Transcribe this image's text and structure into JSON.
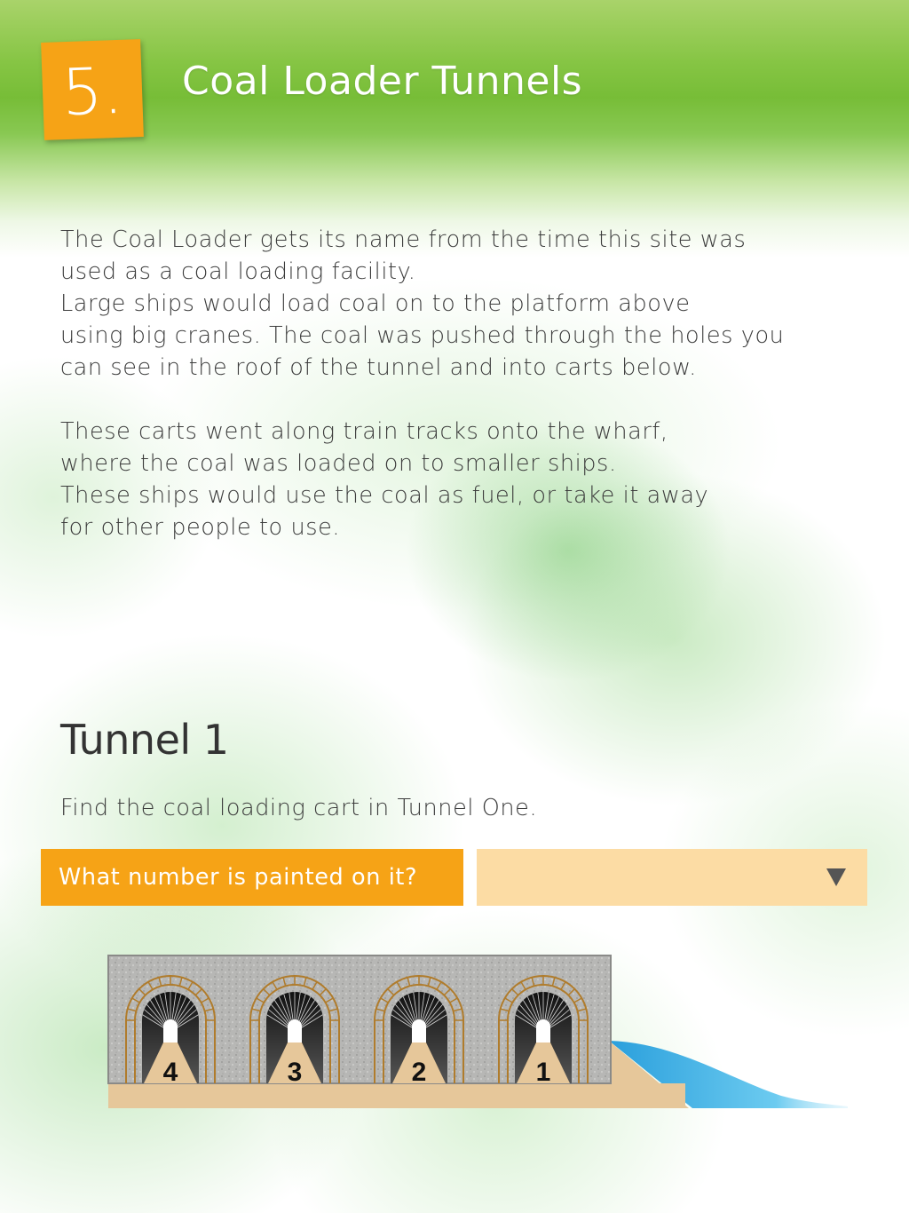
{
  "header": {
    "step_number": "5.",
    "title": "Coal Loader Tunnels"
  },
  "intro": {
    "paragraph_1_lines": [
      "The Coal Loader gets its name from the time this site was",
      "used as a coal loading facility.",
      "Large ships would load coal on to the platform above",
      "using big cranes. The coal was pushed through the holes you",
      "can see in the roof of the tunnel and into carts below."
    ],
    "paragraph_2_lines": [
      "These carts went along train tracks onto the wharf,",
      "where the coal was loaded on to smaller ships.",
      "These ships would use the coal as fuel, or take it away",
      "for other people to use."
    ]
  },
  "activity": {
    "heading": "Tunnel 1",
    "instruction": "Find the coal loading cart in Tunnel One.",
    "question": "What number is painted on it?",
    "selected_answer": ""
  },
  "diagram": {
    "tunnel_labels": [
      "4",
      "3",
      "2",
      "1"
    ]
  },
  "colors": {
    "accent_orange": "#f6a316",
    "select_background": "#fcdca4",
    "header_green": "#77bd37",
    "water_blue": "#3aa9e0",
    "ground_tan": "#e6c79a"
  }
}
